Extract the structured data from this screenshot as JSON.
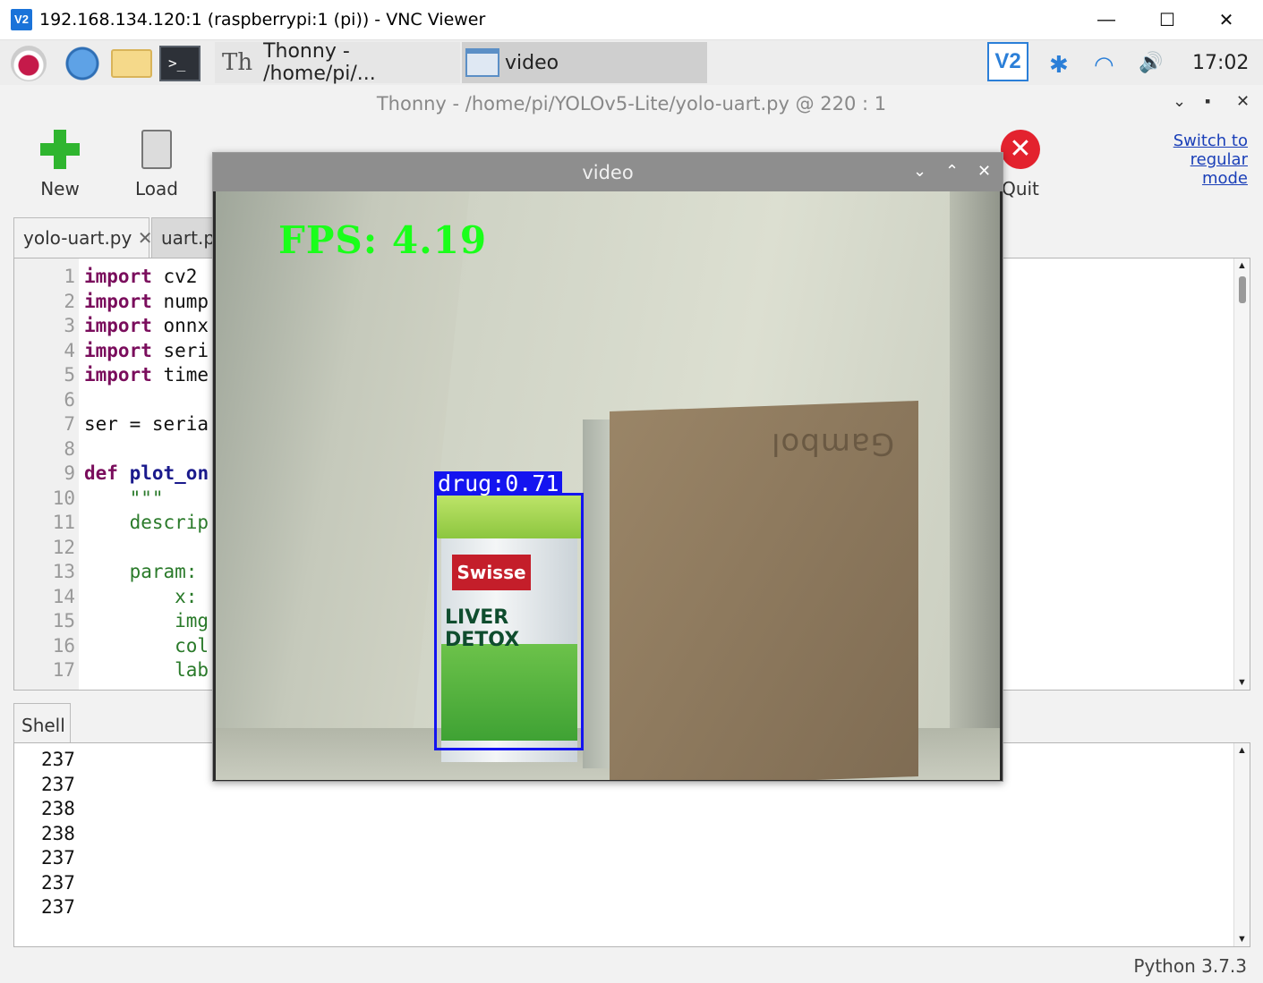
{
  "vnc": {
    "logo": "V2",
    "title": "192.168.134.120:1 (raspberrypi:1 (pi)) - VNC Viewer",
    "minimize": "—",
    "maximize": "☐",
    "close": "✕"
  },
  "taskbar": {
    "terminal_glyph": ">_",
    "thonny_task": "Thonny  -  /home/pi/...",
    "video_task": "video",
    "tray_vnc": "V2",
    "bluetooth": "✱",
    "wifi": "◠",
    "volume": "🔊",
    "clock": "17:02"
  },
  "thonny": {
    "title": "Thonny  -  /home/pi/YOLOv5-Lite/yolo-uart.py  @  220 : 1",
    "ctrl_collapse": "⌄",
    "ctrl_restore": "▪",
    "ctrl_close": "✕",
    "toolbar": {
      "new": "New",
      "load": "Load",
      "quit": "Quit",
      "quit_glyph": "✕",
      "switch_mode": "Switch to regular mode"
    },
    "tabs": [
      {
        "label": "yolo-uart.py",
        "close": "✕"
      },
      {
        "label": "uart.py"
      }
    ],
    "line_numbers": [
      "1",
      "2",
      "3",
      "4",
      "5",
      "6",
      "7",
      "8",
      "9",
      "10",
      "11",
      "12",
      "13",
      "14",
      "15",
      "16",
      "17"
    ],
    "code": {
      "l1_kw": "import",
      "l1_rest": " cv2",
      "l2_kw": "import",
      "l2_rest": " nump",
      "l3_kw": "import",
      "l3_rest": " onnx",
      "l4_kw": "import",
      "l4_rest": " seri",
      "l5_kw": "import",
      "l5_rest": " time",
      "l7": "ser = seria",
      "l9_kw": "def",
      "l9_fn": " plot_on",
      "l10": "    \"\"\"",
      "l11": "    descrip",
      "l13": "    param:",
      "l14": "        x:",
      "l15": "        img",
      "l16": "        col",
      "l17": "        lab"
    },
    "shell_tab": "Shell",
    "shell_lines": [
      "237",
      "237",
      "238",
      "238",
      "237",
      "237",
      "237"
    ],
    "status": "Python 3.7.3"
  },
  "video": {
    "title": "video",
    "ctrl_collapse": "⌄",
    "ctrl_up": "⌃",
    "ctrl_close": "✕",
    "fps": "FPS: 4.19",
    "detection_label": "drug:0.71",
    "box_color": "#1414f0",
    "jar_brand": "Swisse",
    "jar_name": "LIVER DETOX",
    "book_text": "Gambol"
  }
}
